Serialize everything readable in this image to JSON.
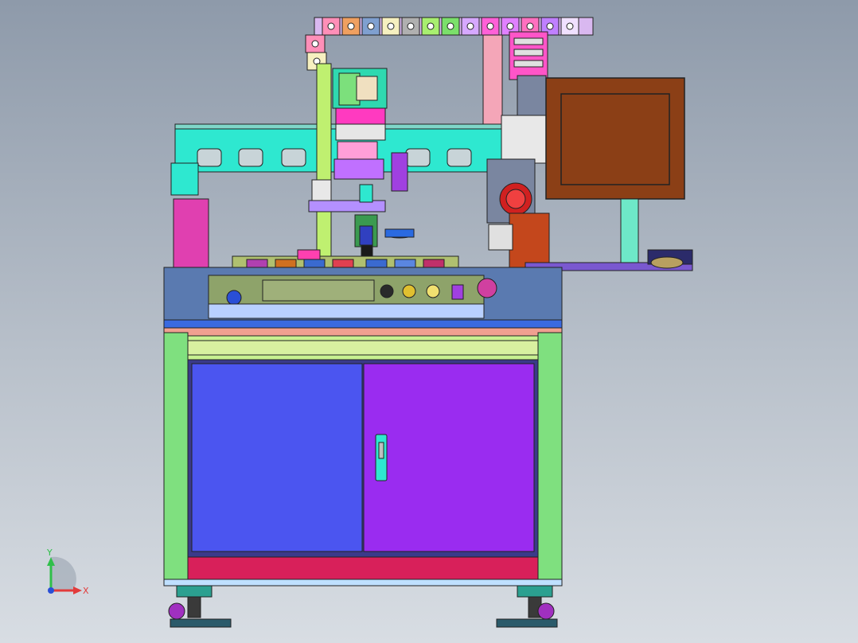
{
  "viewport": {
    "background_top": "#8e9aaa",
    "background_bottom": "#d8dde3"
  },
  "triad": {
    "y_label": "Y",
    "x_label": "X",
    "y_color": "#2fbf4a",
    "x_color": "#e23b3b",
    "z_color": "#2a4fd6"
  },
  "colors": {
    "frame": "#7fe07f",
    "cabinet_left_door": "#4b55f0",
    "cabinet_right_door": "#9a2cf0",
    "base_panel": "#d8205a",
    "gantry_beam": "#2ee8d0",
    "monitor_body": "#8b3f16",
    "control_panel": "#8ea36a",
    "cable_chain": "#c8a0e0"
  }
}
